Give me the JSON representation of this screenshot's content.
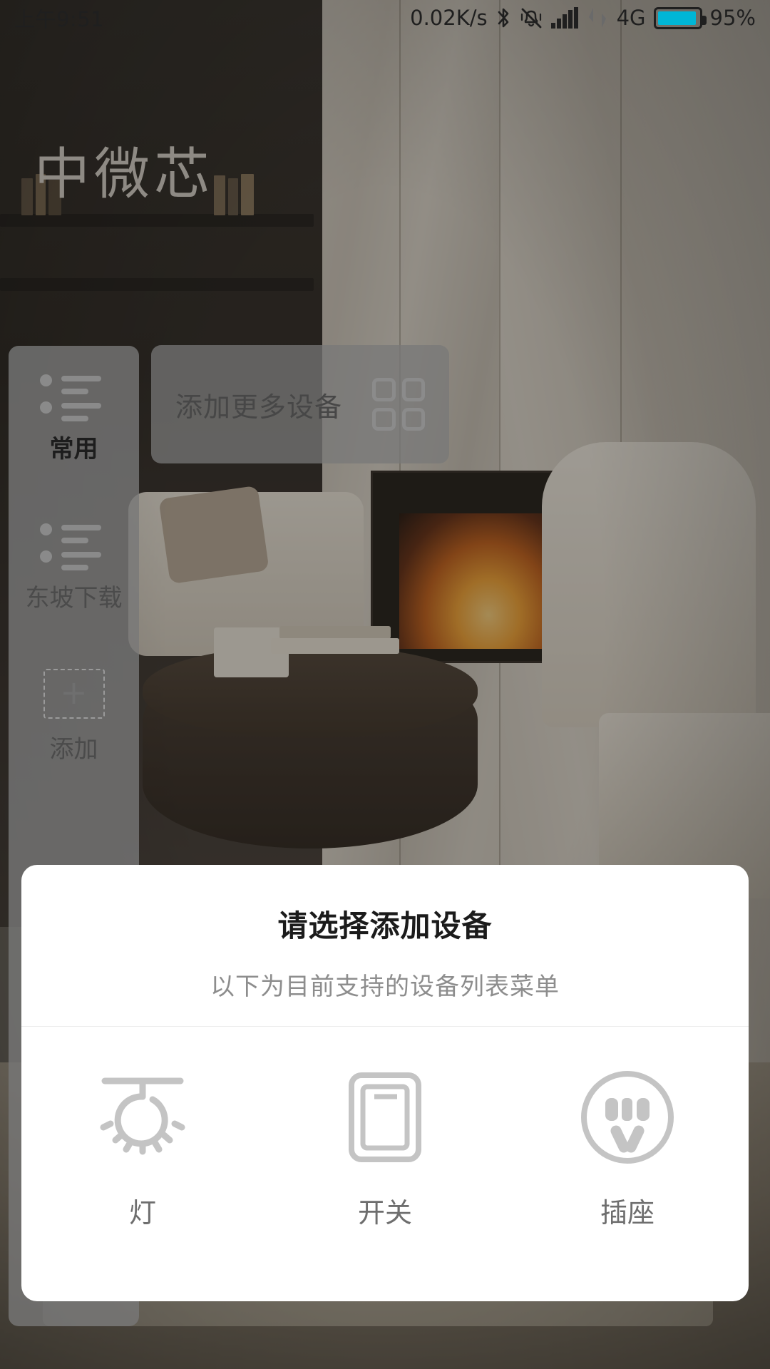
{
  "statusbar": {
    "time": "上午9:51",
    "network_speed": "0.02K/s",
    "bluetooth_icon": "bluetooth-icon",
    "mute_icon": "vibrate-mute-icon",
    "signal_icon": "cellular-signal-icon",
    "data_icon": "data-transfer-icon",
    "network_type": "4G",
    "battery_icon": "battery-icon",
    "battery_percent": "95%",
    "battery_level": 95,
    "battery_color": "#00b6d6"
  },
  "app": {
    "title": "中微芯"
  },
  "rail": {
    "items": [
      {
        "label": "常用",
        "icon": "list-icon",
        "selected": true
      },
      {
        "label": "东坡下载",
        "icon": "list-icon",
        "selected": false
      },
      {
        "label": "添加",
        "icon": "plus-box-icon",
        "selected": false
      }
    ]
  },
  "add_card": {
    "label": "添加更多设备",
    "icon": "grid-four-squares-icon"
  },
  "sheet": {
    "title": "请选择添加设备",
    "subtitle": "以下为目前支持的设备列表菜单",
    "devices": [
      {
        "label": "灯",
        "icon": "ceiling-light-icon"
      },
      {
        "label": "开关",
        "icon": "wall-switch-icon"
      },
      {
        "label": "插座",
        "icon": "power-socket-icon"
      }
    ]
  },
  "colors": {
    "sheet_bg": "#ffffff",
    "icon_gray": "#c4c4c4",
    "text_primary": "#1b1b1b",
    "text_secondary": "#8d8d8d",
    "rail_bg": "rgba(120,120,120,0.80)"
  }
}
